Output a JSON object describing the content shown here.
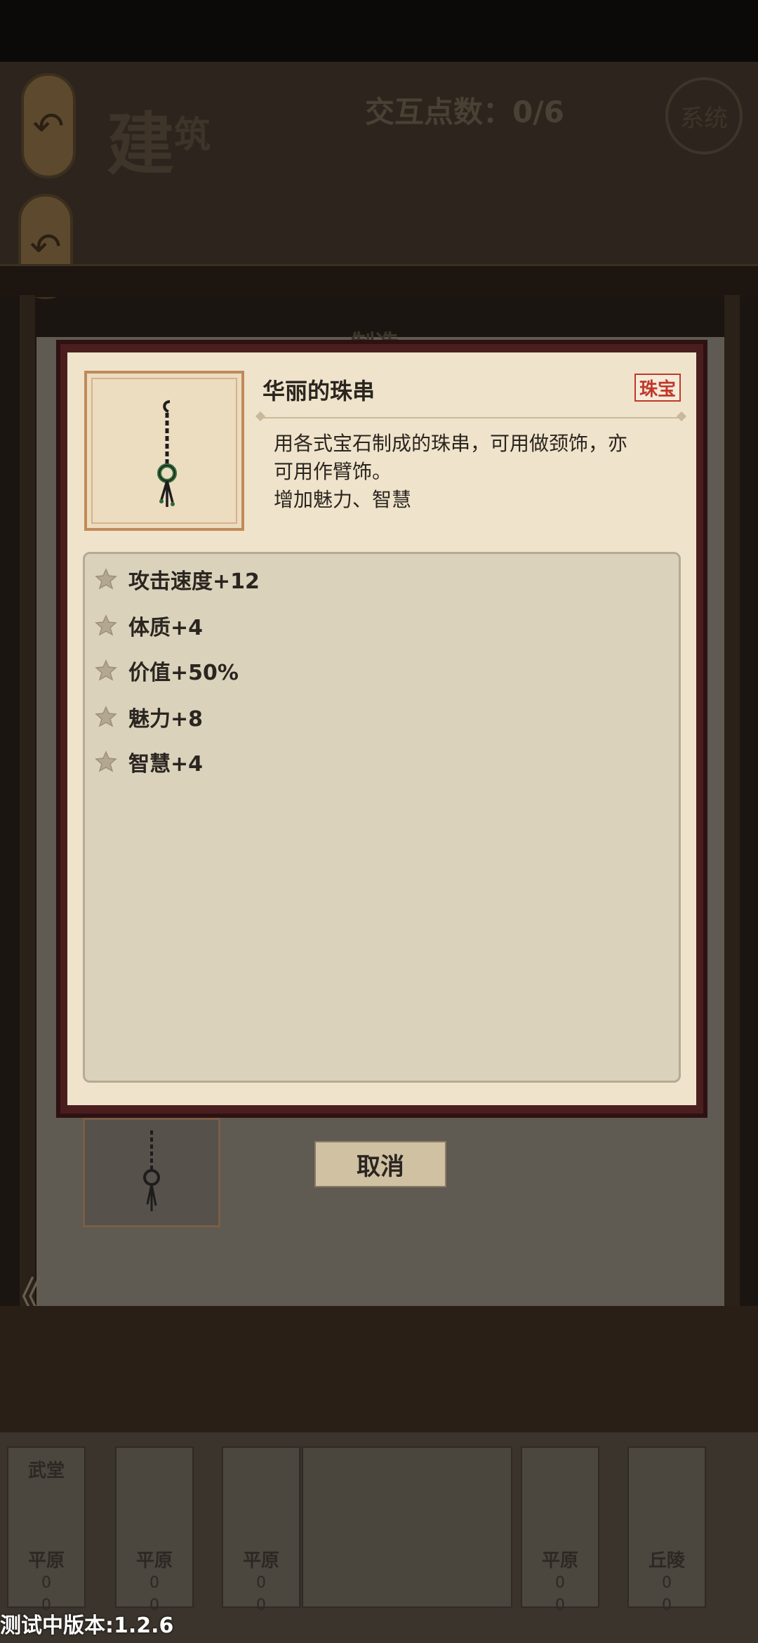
{
  "header": {
    "title_big": "建",
    "title_small": "筑",
    "interaction_points": "交互点数：0/6",
    "system_button": "系统"
  },
  "back_buttons": [
    {
      "icon": "back-arrow-icon",
      "glyph": "↶"
    },
    {
      "icon": "back-arrow-icon",
      "glyph": "↶"
    }
  ],
  "background": {
    "panel_tab": "制造",
    "left_arrow": "《",
    "cancel_label": "取消",
    "building_cards": [
      {
        "top": "武堂",
        "terrain": "平原",
        "v1": "0",
        "v2": "0"
      },
      {
        "top": "",
        "terrain": "平原",
        "v1": "0",
        "v2": "0"
      },
      {
        "top": "",
        "terrain": "平原",
        "v1": "0",
        "v2": "0"
      },
      {
        "top": "",
        "terrain": "平原",
        "v1": "0",
        "v2": "0"
      },
      {
        "top": "",
        "terrain": "丘陵",
        "v1": "0",
        "v2": "0"
      }
    ],
    "version": "测试中版本:1.2.6"
  },
  "popup": {
    "item_name": "华丽的珠串",
    "category": "珠宝",
    "description_lines": [
      "用各式宝石制成的珠串，可用做颈饰，亦",
      "可用作臂饰。",
      "增加魅力、智慧"
    ],
    "stats": [
      {
        "label": "攻击速度+12",
        "icon": "flower-icon"
      },
      {
        "label": "体质+4",
        "icon": "flower-icon"
      },
      {
        "label": "价值+50%",
        "icon": "flower-icon"
      },
      {
        "label": "魅力+8",
        "icon": "flower-icon"
      },
      {
        "label": "智慧+4",
        "icon": "flower-icon"
      }
    ]
  },
  "colors": {
    "popup_frame": "#4a1e1f",
    "popup_paper": "#efe4cb",
    "category_red": "#c0392b",
    "stats_panel": "#dbd2bc"
  }
}
